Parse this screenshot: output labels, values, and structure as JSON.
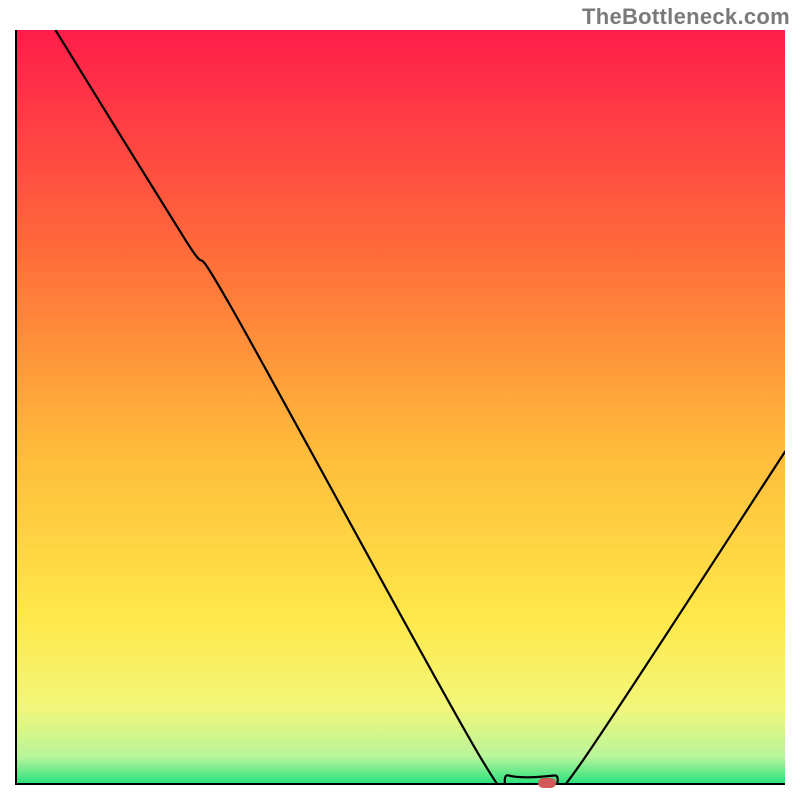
{
  "attribution": "TheBottleneck.com",
  "chart_data": {
    "type": "line",
    "title": "",
    "xlabel": "",
    "ylabel": "",
    "xlim": [
      0,
      100
    ],
    "ylim": [
      0,
      100
    ],
    "gradient_stops": [
      {
        "offset": 0,
        "color": "#ff1d4b"
      },
      {
        "offset": 0.3,
        "color": "#ff6d3a"
      },
      {
        "offset": 0.55,
        "color": "#ffb93a"
      },
      {
        "offset": 0.78,
        "color": "#ffe84a"
      },
      {
        "offset": 0.9,
        "color": "#f2f67a"
      },
      {
        "offset": 0.965,
        "color": "#b9f59a"
      },
      {
        "offset": 1.0,
        "color": "#2de27e"
      }
    ],
    "curve": [
      {
        "x": 5,
        "y": 100
      },
      {
        "x": 22,
        "y": 72
      },
      {
        "x": 28,
        "y": 63
      },
      {
        "x": 60,
        "y": 4
      },
      {
        "x": 64,
        "y": 1
      },
      {
        "x": 70,
        "y": 1
      },
      {
        "x": 73,
        "y": 2
      },
      {
        "x": 100,
        "y": 44
      }
    ],
    "marker": {
      "x": 69,
      "y": 0,
      "color": "#d35a5a"
    }
  }
}
